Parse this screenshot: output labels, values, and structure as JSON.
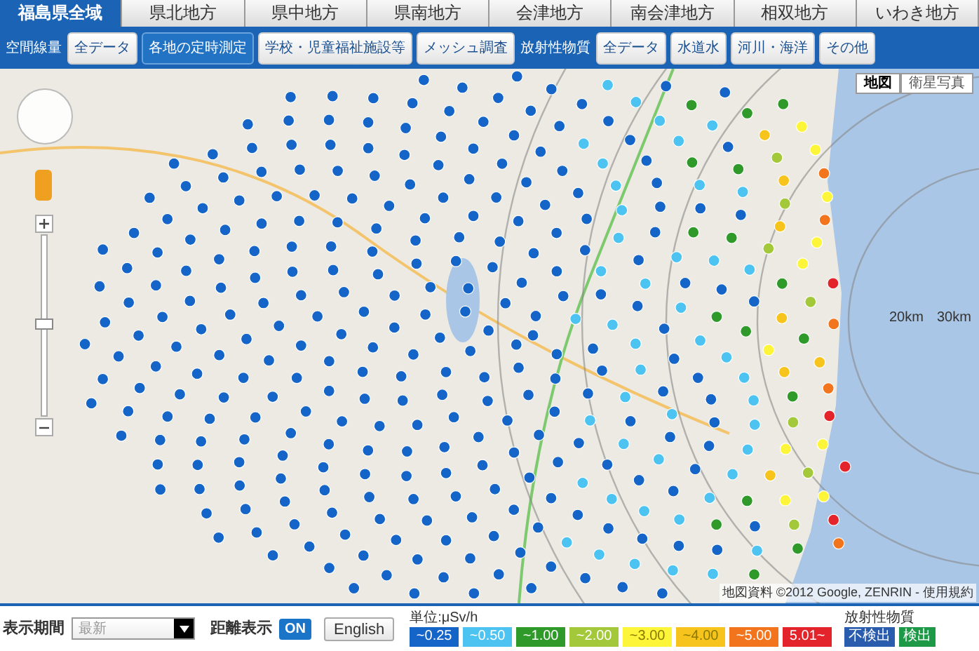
{
  "region_tabs": [
    {
      "label": "福島県全域",
      "selected": true
    },
    {
      "label": "県北地方",
      "selected": false
    },
    {
      "label": "県中地方",
      "selected": false
    },
    {
      "label": "県南地方",
      "selected": false
    },
    {
      "label": "会津地方",
      "selected": false
    },
    {
      "label": "南会津地方",
      "selected": false
    },
    {
      "label": "相双地方",
      "selected": false
    },
    {
      "label": "いわき地方",
      "selected": false
    }
  ],
  "filters": [
    {
      "kind": "label",
      "label": "空間線量"
    },
    {
      "kind": "button",
      "label": "全データ",
      "selected": false
    },
    {
      "kind": "button",
      "label": "各地の定時測定",
      "selected": true
    },
    {
      "kind": "button",
      "label": "学校・児童福祉施設等",
      "selected": false
    },
    {
      "kind": "button",
      "label": "メッシュ調査",
      "selected": false
    },
    {
      "kind": "label",
      "label": "放射性物質"
    },
    {
      "kind": "button",
      "label": "全データ",
      "selected": false
    },
    {
      "kind": "button",
      "label": "水道水",
      "selected": false
    },
    {
      "kind": "button",
      "label": "河川・海洋",
      "selected": false
    },
    {
      "kind": "button",
      "label": "その他",
      "selected": false
    }
  ],
  "map": {
    "map_types": [
      {
        "label": "地図",
        "selected": true
      },
      {
        "label": "衛星写真",
        "selected": false
      }
    ],
    "ring_labels": [
      "20km",
      "30km"
    ],
    "attribution": "地図資料 ©2012 Google, ZENRIN - 使用規約"
  },
  "bottom_bar": {
    "period_label": "表示期間",
    "period_value": "最新",
    "distance_label": "距離表示",
    "distance_on": true,
    "distance_toggle": "ON",
    "language_button": "English",
    "unit": "単位:μSv/h",
    "legend": [
      {
        "label": "~0.25",
        "color": "#1565c8"
      },
      {
        "label": "~0.50",
        "color": "#4cc3f0"
      },
      {
        "label": "~1.00",
        "color": "#2f9a2a"
      },
      {
        "label": "~2.00",
        "color": "#a3c83a"
      },
      {
        "label": "~3.00",
        "color": "#fdf53a"
      },
      {
        "label": "~4.00",
        "color": "#f7c31d"
      },
      {
        "label": "~5.00",
        "color": "#f2751e"
      },
      {
        "label": "5.01~",
        "color": "#e3242b"
      }
    ],
    "substance_label": "放射性物質",
    "substance_legend": [
      {
        "label": "不検出",
        "color": "#2a5cae"
      },
      {
        "label": "検出",
        "color": "#1e9948"
      }
    ]
  }
}
